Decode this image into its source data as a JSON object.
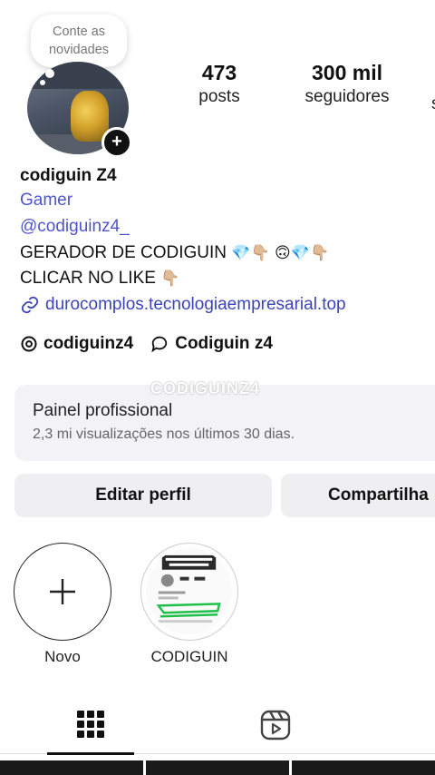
{
  "note": {
    "line1": "Conte as",
    "line2": "novidades"
  },
  "stats": [
    {
      "value": "473",
      "label": "posts"
    },
    {
      "value": "300 mil",
      "label": "seguidores"
    }
  ],
  "profile": {
    "name": "codiguin Z4",
    "category": "Gamer",
    "handle": "@codiguinz4_",
    "bio_line1": "GERADOR DE CODIGUIN",
    "bio_line1_emojis": "💎👇🏼 🙃💎👇🏼",
    "bio_line2": "CLICAR NO LIKE",
    "bio_line2_emoji": "👇🏼",
    "link": "durocomplos.tecnologiaempresarial.top"
  },
  "threads": [
    {
      "icon": "threads-icon",
      "label": "codiguinz4"
    },
    {
      "icon": "chat-bubble-icon",
      "label": "Codiguin z4"
    }
  ],
  "watermark": "CODIGUINZ4",
  "panel": {
    "title": "Painel profissional",
    "subtitle": "2,3 mi visualizações nos últimos 30 dias."
  },
  "buttons": {
    "edit": "Editar perfil",
    "share": "Compartilha"
  },
  "highlights": [
    {
      "label": "Novo",
      "icon": "plus-icon"
    },
    {
      "label": "CODIGUIN",
      "icon": "highlight-cover"
    }
  ],
  "tabs": [
    {
      "name": "grid",
      "icon": "grid-icon",
      "active": true
    },
    {
      "name": "reels",
      "icon": "reels-icon",
      "active": false
    }
  ],
  "colors": {
    "link": "#3b44b8",
    "category": "#4f55c9",
    "panel_bg": "#f3f3f5",
    "button_bg": "#efeff1"
  }
}
